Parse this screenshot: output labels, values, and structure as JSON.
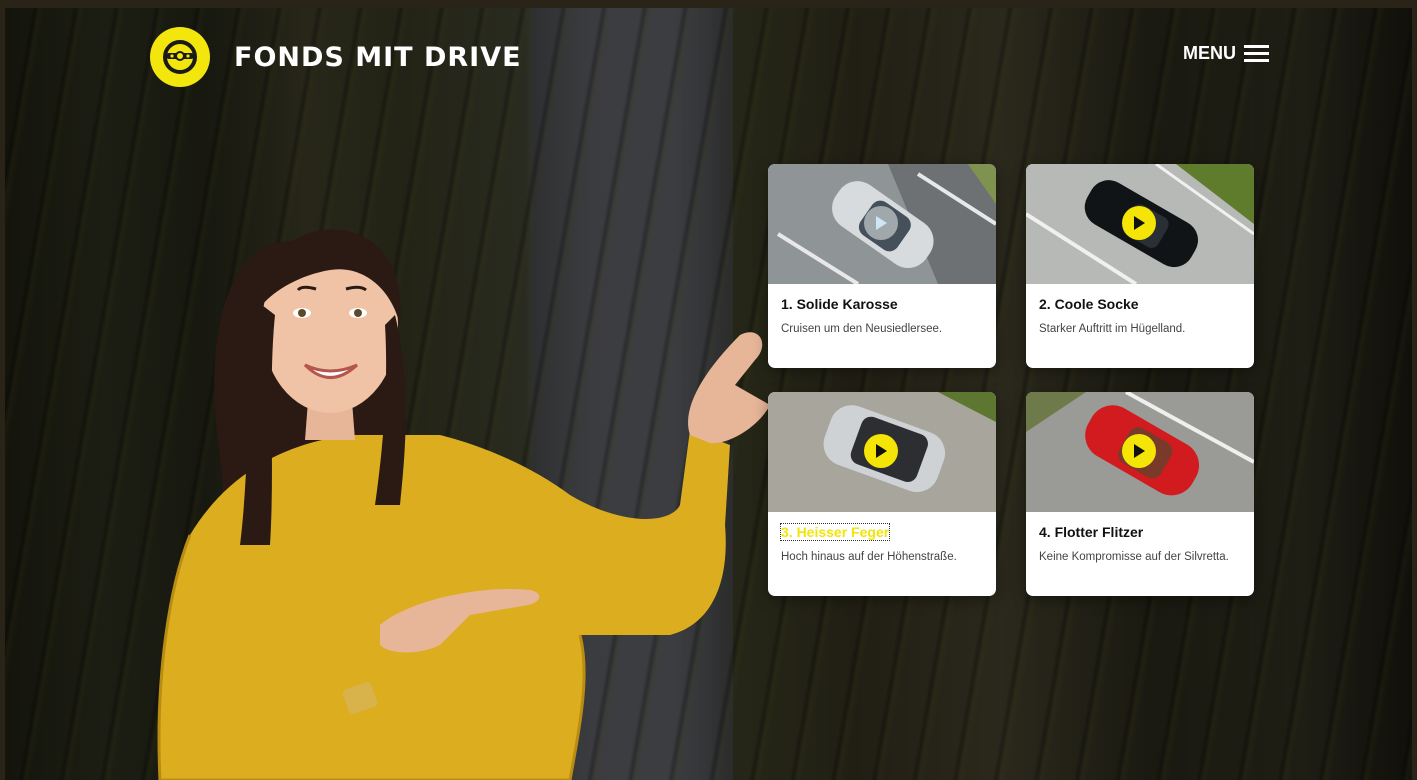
{
  "header": {
    "brand": "FONDS MIT DRIVE",
    "menu_label": "MENU",
    "logo_icon": "steering-wheel-icon",
    "menu_icon": "hamburger-icon"
  },
  "colors": {
    "accent": "#f3e60c",
    "card_bg": "#ffffff",
    "title_text": "#111111"
  },
  "cards": [
    {
      "title": "1. Solide Karosse",
      "description": "Cruisen um den Neusiedlersee.",
      "icon": "play-icon"
    },
    {
      "title": "2. Coole Socke",
      "description": "Starker Auftritt im Hügelland.",
      "icon": "play-icon"
    },
    {
      "title": "3. Heisser Feger",
      "description": "Hoch hinaus auf der Höhenstraße.",
      "icon": "play-icon"
    },
    {
      "title": "4. Flotter Flitzer",
      "description": "Keine Kompromisse auf der Silvretta.",
      "icon": "play-icon"
    }
  ]
}
